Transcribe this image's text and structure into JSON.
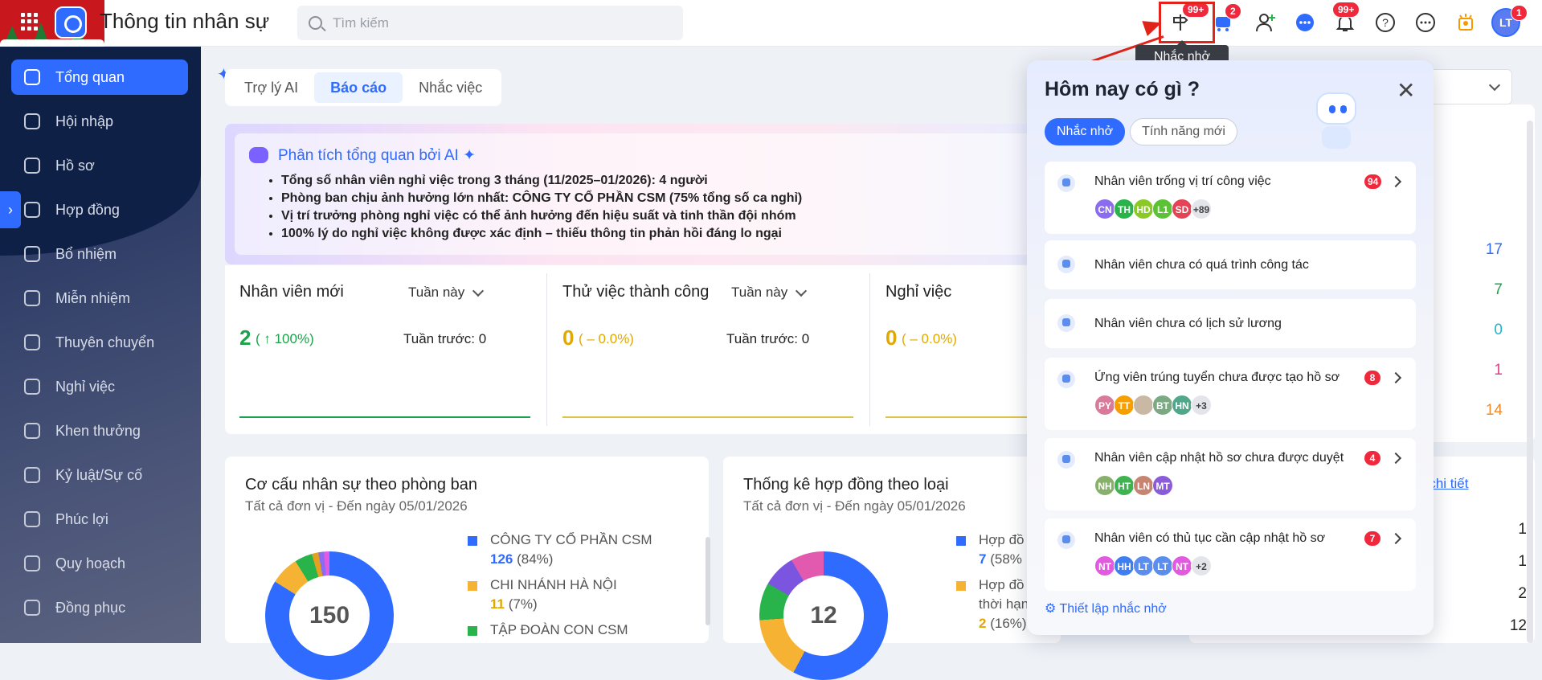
{
  "header": {
    "title": "Thông tin nhân sự",
    "search_placeholder": "Tìm kiếm",
    "badges": {
      "reminder": "99+",
      "cart": "2",
      "notifications": "99+",
      "avatar": "1"
    },
    "avatar_initials": "LT",
    "tooltip": "Nhắc nhở"
  },
  "sidebar": {
    "items": [
      {
        "label": "Tổng quan",
        "icon": "home-icon"
      },
      {
        "label": "Hội nhập",
        "icon": "users-icon"
      },
      {
        "label": "Hồ sơ",
        "icon": "user-icon"
      },
      {
        "label": "Hợp đồng",
        "icon": "document-icon"
      },
      {
        "label": "Bổ nhiệm",
        "icon": "user-plus-icon"
      },
      {
        "label": "Miễn nhiệm",
        "icon": "user-minus-icon"
      },
      {
        "label": "Thuyên chuyển",
        "icon": "transfer-icon"
      },
      {
        "label": "Nghỉ việc",
        "icon": "user-x-icon"
      },
      {
        "label": "Khen thưởng",
        "icon": "award-icon"
      },
      {
        "label": "Kỷ luật/Sự cố",
        "icon": "warning-icon"
      },
      {
        "label": "Phúc lợi",
        "icon": "gift-icon"
      },
      {
        "label": "Quy hoạch",
        "icon": "plan-icon"
      },
      {
        "label": "Đồng phục",
        "icon": "shirt-icon"
      }
    ]
  },
  "main": {
    "tabs": [
      "Trợ lý AI",
      "Báo cáo",
      "Nhắc việc"
    ],
    "ai": {
      "title": "Phân tích tổng quan bởi AI",
      "points": [
        "Tổng số nhân viên nghỉ việc trong 3 tháng (11/2025–01/2026): 4 người",
        "Phòng ban chịu ảnh hưởng lớn nhất: CÔNG TY CỔ PHẦN CSM (75% tổng số ca nghỉ)",
        "Vị trí trưởng phòng nghỉ việc có thể ảnh hưởng đến hiệu suất và tinh thần đội nhóm",
        "100% lý do nghỉ việc không được xác định – thiếu thông tin phản hồi đáng lo ngại"
      ]
    },
    "stats": [
      {
        "title": "Nhân viên mới",
        "period": "Tuần này",
        "value": "2",
        "change": "( ↑ 100%)",
        "previous": "Tuần trước: 0",
        "color": "#1aa34a"
      },
      {
        "title": "Thử việc thành công",
        "period": "Tuần này",
        "value": "0",
        "change": "( – 0.0%)",
        "previous": "Tuần trước: 0",
        "color": "#e0a800"
      },
      {
        "title": "Nghỉ việc",
        "value": "0",
        "change": "( – 0.0%)",
        "color": "#e0a800"
      }
    ],
    "cards": {
      "structure": {
        "title": "Cơ cấu nhân sự theo phòng ban",
        "subtitle": "Tất cả đơn vị - Đến ngày 05/01/2026",
        "total": "150",
        "legend": [
          {
            "name": "CÔNG TY CỔ PHẦN CSM",
            "count": "126",
            "pct": "(84%)",
            "color": "#2f6bff"
          },
          {
            "name": "CHI NHÁNH HÀ NỘI",
            "count": "11",
            "pct": "(7%)",
            "color": "#f5b233"
          },
          {
            "name": "TẬP ĐOÀN CON CSM",
            "color": "#28b44a"
          }
        ]
      },
      "contracts": {
        "title": "Thống kê hợp đồng theo loại",
        "subtitle": "Tất cả đơn vị - Đến ngày 05/01/2026",
        "total": "12",
        "legend": [
          {
            "name": "Hợp đồ",
            "count": "7",
            "pct": "(58%",
            "color": "#2f6bff"
          },
          {
            "name": "Hợp đồ",
            "name2": "thời hạn",
            "count": "2",
            "pct": "(16%)",
            "color": "#f5b233"
          }
        ]
      }
    },
    "right_numbers": [
      "17",
      "7",
      "0",
      "1",
      "14"
    ],
    "right_link": "em chi tiết",
    "right_list": [
      "1",
      "1",
      "2",
      "12"
    ]
  },
  "popup": {
    "title": "Hôm nay có gì ?",
    "tabs": [
      "Nhắc nhở",
      "Tính năng mới"
    ],
    "items": [
      {
        "label": "Nhân viên trống vị trí công việc",
        "count": "94",
        "avatars": [
          {
            "t": "CN",
            "c": "#8b6cf0"
          },
          {
            "t": "TH",
            "c": "#28b44a"
          },
          {
            "t": "HD",
            "c": "#8ac926"
          },
          {
            "t": "L1",
            "c": "#5bc236"
          },
          {
            "t": "SD",
            "c": "#e64256"
          }
        ],
        "more": "+89"
      },
      {
        "label": "Nhân viên chưa có quá trình công tác"
      },
      {
        "label": "Nhân viên chưa có lịch sử lương"
      },
      {
        "label": "Ứng viên trúng tuyển chưa được tạo hồ sơ",
        "count": "8",
        "avatars": [
          {
            "t": "PY",
            "c": "#d97a9a"
          },
          {
            "t": "TT",
            "c": "#f5a000"
          },
          {
            "t": "",
            "c": "#c9b8a4"
          },
          {
            "t": "BT",
            "c": "#7aa982"
          },
          {
            "t": "HN",
            "c": "#4fa88a"
          }
        ],
        "more": "+3"
      },
      {
        "label": "Nhân viên cập nhật hồ sơ chưa được duyệt",
        "count": "4",
        "avatars": [
          {
            "t": "NH",
            "c": "#88b06a"
          },
          {
            "t": "HT",
            "c": "#3fb34f"
          },
          {
            "t": "LN",
            "c": "#c78470"
          },
          {
            "t": "MT",
            "c": "#8a5cd8"
          }
        ]
      },
      {
        "label": "Nhân viên có thủ tục cần cập nhật hồ sơ",
        "count": "7",
        "avatars": [
          {
            "t": "NT",
            "c": "#e25ae0"
          },
          {
            "t": "HH",
            "c": "#3f7ef0"
          },
          {
            "t": "LT",
            "c": "#5b8def"
          },
          {
            "t": "LT",
            "c": "#5b8def"
          },
          {
            "t": "NT",
            "c": "#e25ae0"
          }
        ],
        "more": "+2"
      }
    ],
    "setting_link": "⚙ Thiết lập nhắc nhở"
  },
  "colors": {
    "accent": "#2f6bff",
    "danger": "#f0283c"
  }
}
